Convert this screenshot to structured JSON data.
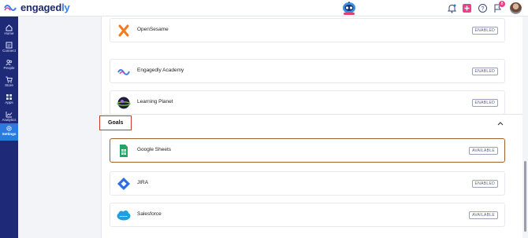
{
  "app": {
    "logo_main": "engaged",
    "logo_accent": "ly"
  },
  "topbar": {
    "icons": [
      "bell-icon",
      "plus-icon",
      "help-icon",
      "flag-icon",
      "avatar"
    ],
    "flag_badge_count": "8",
    "accent_color": "#e9408b"
  },
  "sidebar": {
    "items": [
      {
        "label": "Home",
        "icon": "home-icon"
      },
      {
        "label": "Connect",
        "icon": "connect-icon"
      },
      {
        "label": "People",
        "icon": "people-icon"
      },
      {
        "label": "Store",
        "icon": "cart-icon"
      },
      {
        "label": "Apps",
        "icon": "apps-icon"
      },
      {
        "label": "Analytics",
        "icon": "analytics-icon"
      },
      {
        "label": "Settings",
        "icon": "gear-icon",
        "active": true
      }
    ],
    "bg_color": "#1e2a78",
    "active_color": "#2b7ae0"
  },
  "learning_integrations": [
    {
      "name": "OpenSesame",
      "status": "ENABLED",
      "icon": "opensesame-icon"
    },
    {
      "name": "Engagedly Academy",
      "status": "ENABLED",
      "icon": "engagedly-academy-icon"
    },
    {
      "name": "Learning Planet",
      "status": "ENABLED",
      "icon": "learning-planet-icon"
    }
  ],
  "goals": {
    "title": "Goals",
    "items": [
      {
        "name": "Google Sheets",
        "status": "AVAILABLE",
        "icon": "google-sheets-icon",
        "highlighted": true
      },
      {
        "name": "JIRA",
        "status": "ENABLED",
        "icon": "jira-icon"
      },
      {
        "name": "Salesforce",
        "status": "AVAILABLE",
        "icon": "salesforce-icon"
      }
    ]
  }
}
